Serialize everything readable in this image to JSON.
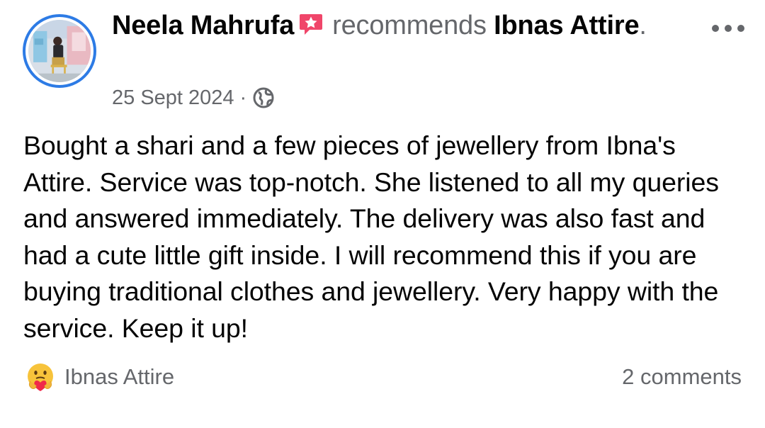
{
  "post": {
    "author_name": "Neela Mahrufa",
    "verb": "recommends",
    "page_name": "Ibnas Attire",
    "end_punct": ".",
    "date": "25 Sept 2024",
    "separator": "·",
    "audience_icon": "globe-icon",
    "recommend_icon": "recommend-star-icon",
    "body": "Bought a shari and a few pieces of jewellery from Ibna's Attire. Service was top-notch. She listened to all my queries and answered immediately. The delivery was also fast and had a cute little gift inside. I will recommend this if you are buying traditional clothes and jewellery. Very happy with the service. Keep it up!"
  },
  "footer": {
    "reaction_icon": "care-reaction-icon",
    "reaction_name": "Ibnas Attire",
    "comments": "2 comments"
  },
  "menu": {
    "more_icon": "more-options-icon"
  },
  "colors": {
    "text": "#050505",
    "secondary": "#65676b",
    "avatar_ring": "#2d7be5",
    "recommend_badge": "#f0466a"
  }
}
